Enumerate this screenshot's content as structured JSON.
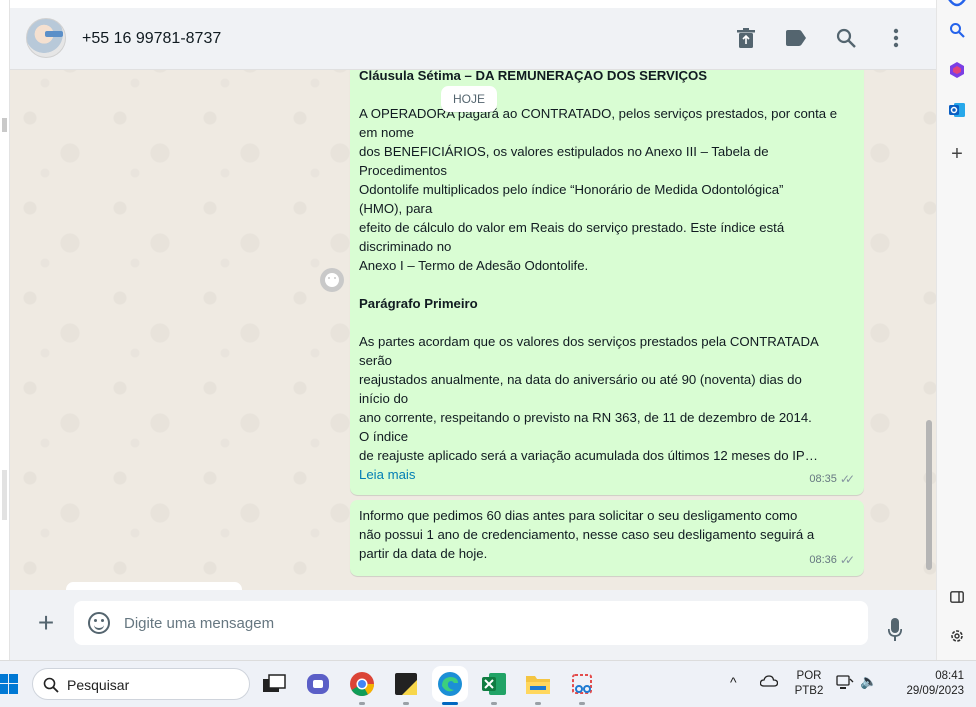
{
  "header": {
    "contact_name": "+55 16 99781-8737",
    "icons": [
      "delete-icon",
      "label-icon",
      "search-icon",
      "more-vertical-icon"
    ]
  },
  "date_pill": "HOJE",
  "messages": [
    {
      "title": "Cláusula Sétima – DA REMUNERAÇÃO DOS SERVIÇOS",
      "lines": [
        "A OPERADORA pagará ao CONTRATADO, pelos serviços prestados, por conta e",
        "em nome",
        "dos BENEFICIÁRIOS, os valores estipulados no Anexo III – Tabela de",
        "Procedimentos",
        "Odontolife multiplicados pelo índice “Honorário de Medida Odontológica”",
        "(HMO), para",
        "efeito de cálculo do valor em Reais do serviço prestado. Este índice está",
        "discriminado no",
        "Anexo I – Termo de Adesão Odontolife."
      ],
      "subtitle": "Parágrafo Primeiro",
      "lines2": [
        "As partes acordam que os valores dos serviços prestados pela CONTRATADA",
        "serão",
        "reajustados anualmente, na data do aniversário ou até 90 (noventa) dias do",
        "início do",
        "ano corrente, respeitando o previsto na RN 363, de 11 de dezembro de 2014.",
        "O índice",
        "de reajuste aplicado será a variação acumulada dos últimos 12 meses do IP…"
      ],
      "read_more": "Leia mais",
      "time": "08:35"
    },
    {
      "lines": [
        "Informo que pedimos 60 dias antes para solicitar o seu desligamento como",
        "não possui 1 ano de credenciamento, nesse caso seu desligamento seguirá a",
        "partir da data de hoje."
      ],
      "time": "08:36"
    }
  ],
  "composer": {
    "placeholder": "Digite uma mensagem"
  },
  "taskbar": {
    "search_label": "Pesquisar",
    "lang_top": "POR",
    "lang_bottom": "PTB2",
    "time": "08:41",
    "date": "29/09/2023"
  },
  "colors": {
    "bubble_out": "#d9fdd3",
    "chat_bg": "#efeae2",
    "header_bg": "#f0f2f5",
    "link": "#027eb5"
  }
}
